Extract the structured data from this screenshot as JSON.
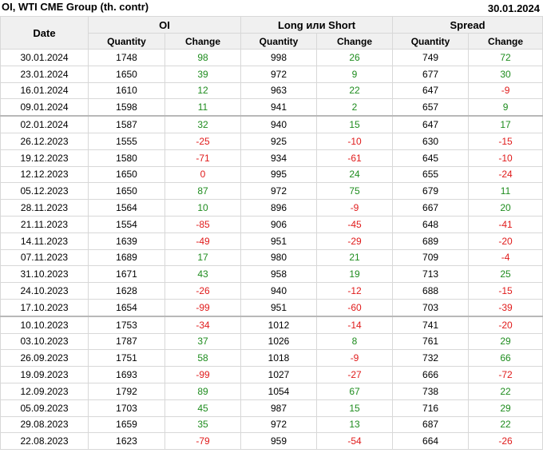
{
  "header": {
    "title": "OI, WTI CME Group (th. contr)",
    "date": "30.01.2024"
  },
  "table": {
    "date_header": "Date",
    "groups": [
      "OI",
      "Long или Short",
      "Spread"
    ],
    "subheaders": [
      "Quantity",
      "Change",
      "Quantity",
      "Change",
      "Quantity",
      "Change"
    ],
    "separators_before": [
      4,
      16
    ],
    "rows": [
      [
        "30.01.2024",
        "1748",
        "98",
        "998",
        "26",
        "749",
        "72"
      ],
      [
        "23.01.2024",
        "1650",
        "39",
        "972",
        "9",
        "677",
        "30"
      ],
      [
        "16.01.2024",
        "1610",
        "12",
        "963",
        "22",
        "647",
        "-9"
      ],
      [
        "09.01.2024",
        "1598",
        "11",
        "941",
        "2",
        "657",
        "9"
      ],
      [
        "02.01.2024",
        "1587",
        "32",
        "940",
        "15",
        "647",
        "17"
      ],
      [
        "26.12.2023",
        "1555",
        "-25",
        "925",
        "-10",
        "630",
        "-15"
      ],
      [
        "19.12.2023",
        "1580",
        "-71",
        "934",
        "-61",
        "645",
        "-10"
      ],
      [
        "12.12.2023",
        "1650",
        "0",
        "995",
        "24",
        "655",
        "-24"
      ],
      [
        "05.12.2023",
        "1650",
        "87",
        "972",
        "75",
        "679",
        "11"
      ],
      [
        "28.11.2023",
        "1564",
        "10",
        "896",
        "-9",
        "667",
        "20"
      ],
      [
        "21.11.2023",
        "1554",
        "-85",
        "906",
        "-45",
        "648",
        "-41"
      ],
      [
        "14.11.2023",
        "1639",
        "-49",
        "951",
        "-29",
        "689",
        "-20"
      ],
      [
        "07.11.2023",
        "1689",
        "17",
        "980",
        "21",
        "709",
        "-4"
      ],
      [
        "31.10.2023",
        "1671",
        "43",
        "958",
        "19",
        "713",
        "25"
      ],
      [
        "24.10.2023",
        "1628",
        "-26",
        "940",
        "-12",
        "688",
        "-15"
      ],
      [
        "17.10.2023",
        "1654",
        "-99",
        "951",
        "-60",
        "703",
        "-39"
      ],
      [
        "10.10.2023",
        "1753",
        "-34",
        "1012",
        "-14",
        "741",
        "-20"
      ],
      [
        "03.10.2023",
        "1787",
        "37",
        "1026",
        "8",
        "761",
        "29"
      ],
      [
        "26.09.2023",
        "1751",
        "58",
        "1018",
        "-9",
        "732",
        "66"
      ],
      [
        "19.09.2023",
        "1693",
        "-99",
        "1027",
        "-27",
        "666",
        "-72"
      ],
      [
        "12.09.2023",
        "1792",
        "89",
        "1054",
        "67",
        "738",
        "22"
      ],
      [
        "05.09.2023",
        "1703",
        "45",
        "987",
        "15",
        "716",
        "29"
      ],
      [
        "29.08.2023",
        "1659",
        "35",
        "972",
        "13",
        "687",
        "22"
      ],
      [
        "22.08.2023",
        "1623",
        "-79",
        "959",
        "-54",
        "664",
        "-26"
      ]
    ]
  },
  "colors": {
    "positive": "#1e8c1e",
    "negative": "#e01b1b",
    "zero": "#e01b1b"
  }
}
